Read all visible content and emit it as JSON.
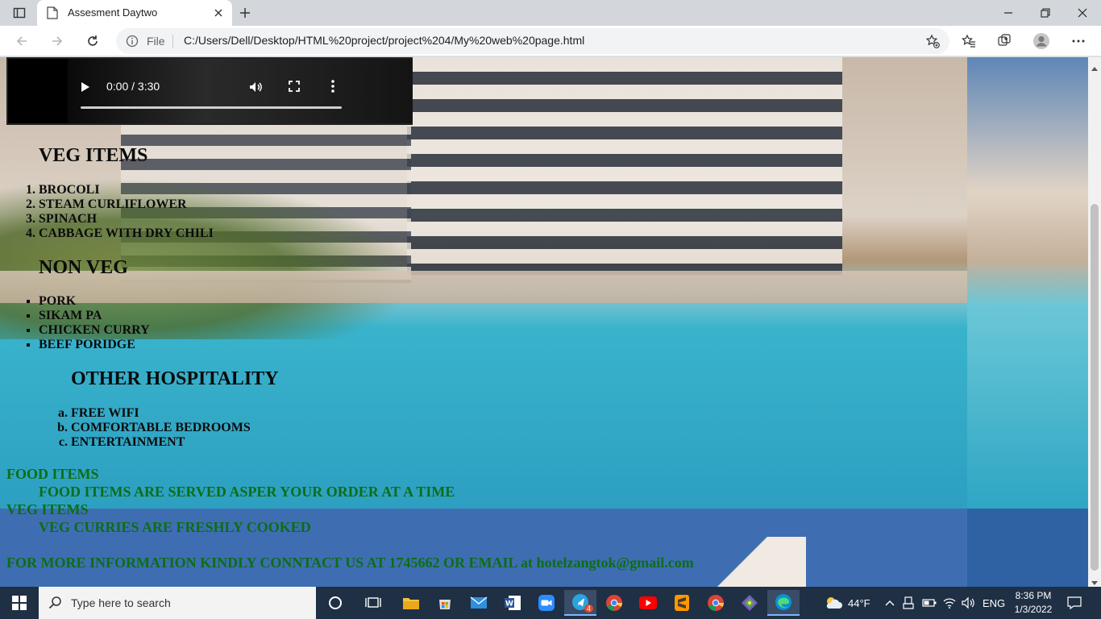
{
  "browser": {
    "tab_title": "Assesment Daytwo",
    "scheme_label": "File",
    "url": "C:/Users/Dell/Desktop/HTML%20project/project%204/My%20web%20page.html"
  },
  "video": {
    "time": "0:00 / 3:30",
    "progress": 0
  },
  "page": {
    "veg_heading": "VEG ITEMS",
    "veg_list": [
      "BROCOLI",
      "STEAM CURLIFLOWER",
      "SPINACH",
      "CABBAGE WITH DRY CHILI"
    ],
    "nonveg_heading": "NON VEG",
    "nonveg_list": [
      "PORK",
      "SIKAM PA",
      "CHICKEN CURRY",
      "BEEF PORIDGE"
    ],
    "hospitality_heading": "OTHER HOSPITALITY",
    "hospitality_list": [
      "FREE WIFI",
      "COMFORTABLE BEDROOMS",
      "ENTERTAINMENT"
    ],
    "food_term": "FOOD ITEMS",
    "food_desc": "FOOD ITEMS ARE SERVED ASPER YOUR ORDER AT A TIME",
    "veg_term": "VEG ITEMS",
    "veg_desc": "VEG CURRIES ARE FRESHLY COOKED",
    "contact": "FOR MORE INFORMATION KINDLY CONNTACT US AT 1745662 OR EMAIL at hotelzangtok@gmail.com"
  },
  "taskbar": {
    "search_placeholder": "Type here to search",
    "weather": "44°F",
    "language": "ENG",
    "time": "8:36 PM",
    "date": "1/3/2022",
    "telegram_badge": "4"
  },
  "colors": {
    "text_green": "#0b6e15",
    "taskbar_bg": "#1f2f44"
  }
}
